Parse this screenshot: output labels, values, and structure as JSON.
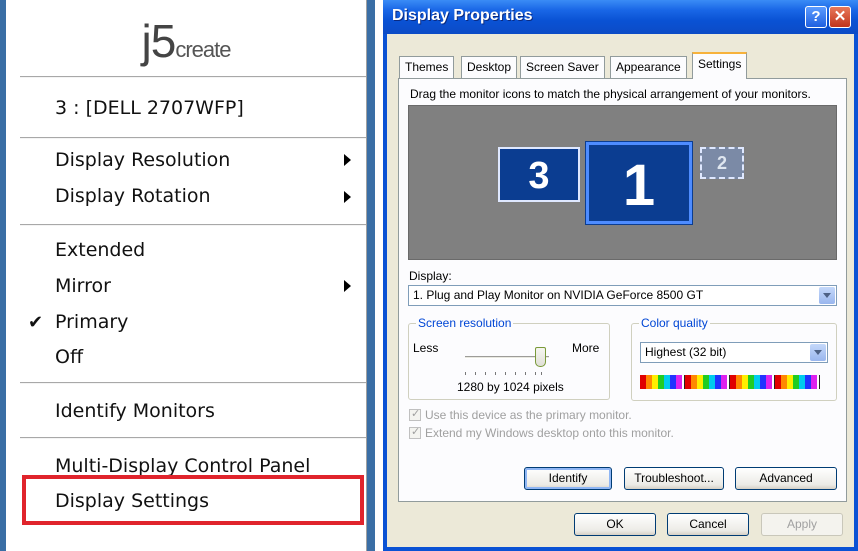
{
  "menu": {
    "logo_main": "j5",
    "logo_sub": "create",
    "monitor": "3 : [DELL 2707WFP]",
    "display_resolution": "Display Resolution",
    "display_rotation": "Display Rotation",
    "extended": "Extended",
    "mirror": "Mirror",
    "primary": "Primary",
    "off": "Off",
    "identify": "Identify Monitors",
    "control_panel": "Multi-Display Control Panel",
    "display_settings": "Display Settings",
    "check_glyph": "✔"
  },
  "dialog": {
    "title": "Display Properties",
    "help_glyph": "?",
    "close_glyph": "✕",
    "tabs": [
      "Themes",
      "Desktop",
      "Screen Saver",
      "Appearance",
      "Settings"
    ],
    "instruction": "Drag the monitor icons to match the physical arrangement of your monitors.",
    "monitors": [
      "3",
      "1",
      "2"
    ],
    "display_label": "Display:",
    "display_value": "1. Plug and Play Monitor on NVIDIA GeForce 8500 GT",
    "resolution": {
      "group": "Screen resolution",
      "less": "Less",
      "more": "More",
      "value": "1280 by 1024 pixels",
      "slider_fraction": 0.9
    },
    "color": {
      "group": "Color quality",
      "value": "Highest (32 bit)"
    },
    "checkbox_primary": "Use this device as the primary monitor.",
    "checkbox_extend": "Extend my Windows desktop onto this monitor.",
    "buttons": {
      "identify": "Identify",
      "troubleshoot": "Troubleshoot...",
      "advanced": "Advanced",
      "ok": "OK",
      "cancel": "Cancel",
      "apply": "Apply"
    }
  },
  "colors": {
    "highlight_box": "#e0242c",
    "title_bar": "#0a52d4",
    "monitor_blue": "#0b3d91"
  }
}
